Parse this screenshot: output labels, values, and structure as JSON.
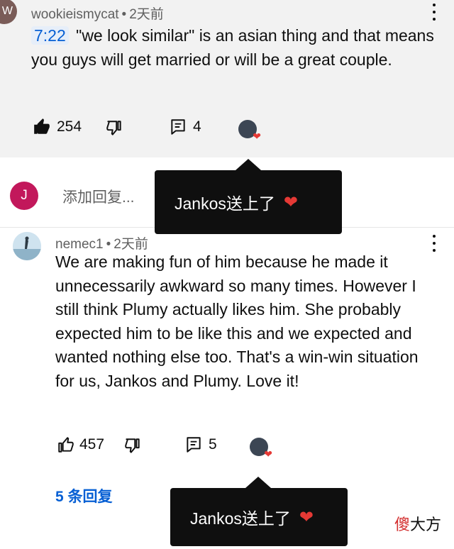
{
  "comments": [
    {
      "avatar_letter": "W",
      "author": "wookieismycat",
      "time": "2天前",
      "timestamp": "7:22",
      "text": " \"we look similar\" is an asian thing and that means you guys will get married or will be a great couple.",
      "likes": "254",
      "replies_count": "4",
      "tooltip": "Jankos送上了"
    },
    {
      "author": "nemec1",
      "time": "2天前",
      "text": "We are making fun of him because he made it unnecessarily awkward so many times. However I still think Plumy actually likes him. She probably expected him to be like this and we expected and wanted nothing else too. That's a win-win situation for us, Jankos and Plumy. Love it!",
      "likes": "457",
      "replies_count": "5",
      "tooltip": "Jankos送上了",
      "replies_link": "5 条回复"
    }
  ],
  "reply_box": {
    "avatar_letter": "J",
    "placeholder": "添加回复..."
  },
  "meta_separator": "•",
  "watermark": {
    "first": "傻",
    "rest": "大方"
  },
  "colors": {
    "link": "#065fd4",
    "heart": "#e53935",
    "tooltip_bg": "#0f0f0f"
  },
  "icons": [
    "like-icon",
    "dislike-icon",
    "reply-icon",
    "creator-heart-icon",
    "more-vert-icon"
  ]
}
